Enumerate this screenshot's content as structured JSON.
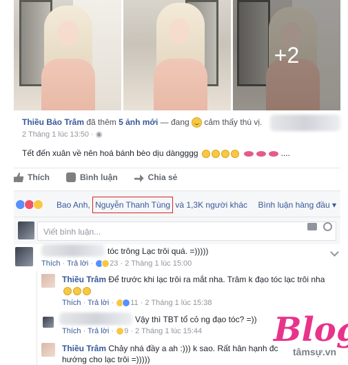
{
  "post": {
    "more_photos": "+2",
    "author": "Thiều Bảo Trâm",
    "action_text": "đã thêm",
    "photo_link": "5 ảnh mới",
    "feeling_prefix": "— đang",
    "feeling": "cảm thấy thú vị.",
    "timestamp": "2 Tháng 1 lúc 13:50 ·",
    "caption": "Tết đến xuân về nên hoá bánh bèo dịu dàngggg",
    "caption_tail": "...."
  },
  "actions": {
    "like": "Thích",
    "comment": "Bình luận",
    "share": "Chia sẻ"
  },
  "reactions": {
    "first": "Bao Anh,",
    "highlight": "Nguyễn Thanh Tùng",
    "rest": "và 1,3K người khác",
    "sort": "Bình luận hàng đầu ▾"
  },
  "composer": {
    "placeholder": "Viết bình luận..."
  },
  "comments": [
    {
      "author": "",
      "text": "tóc trông Lạc trôi quá. =)))))",
      "like": "Thích",
      "reply": "Trả lời",
      "count": "23",
      "time": "2 Tháng 1 lúc 15:00"
    },
    {
      "author": "Thiều Trâm",
      "text": "Để trước khi lạc trôi ra mắt nha. Trâm k đạo tóc lạc trôi nha",
      "like": "Thích",
      "reply": "Trả lời",
      "count": "11",
      "time": "2 Tháng 1 lúc 15:38"
    },
    {
      "author": "",
      "text": "Vậy thì TBT tổ cỏ ng đạo tóc? =))",
      "like": "Thích",
      "reply": "Trả lời",
      "count": "9",
      "time": "2 Tháng 1 lúc 15:44"
    },
    {
      "author": "Thiều Trâm",
      "text": "Chảy nhá đầy a ah :))) k sao. Rất hân hạnh đc",
      "text2": "hướng cho lạc trôi =)))))"
    }
  ],
  "watermark": {
    "letter": "Blog",
    "sub": "tâmsự.vn"
  }
}
